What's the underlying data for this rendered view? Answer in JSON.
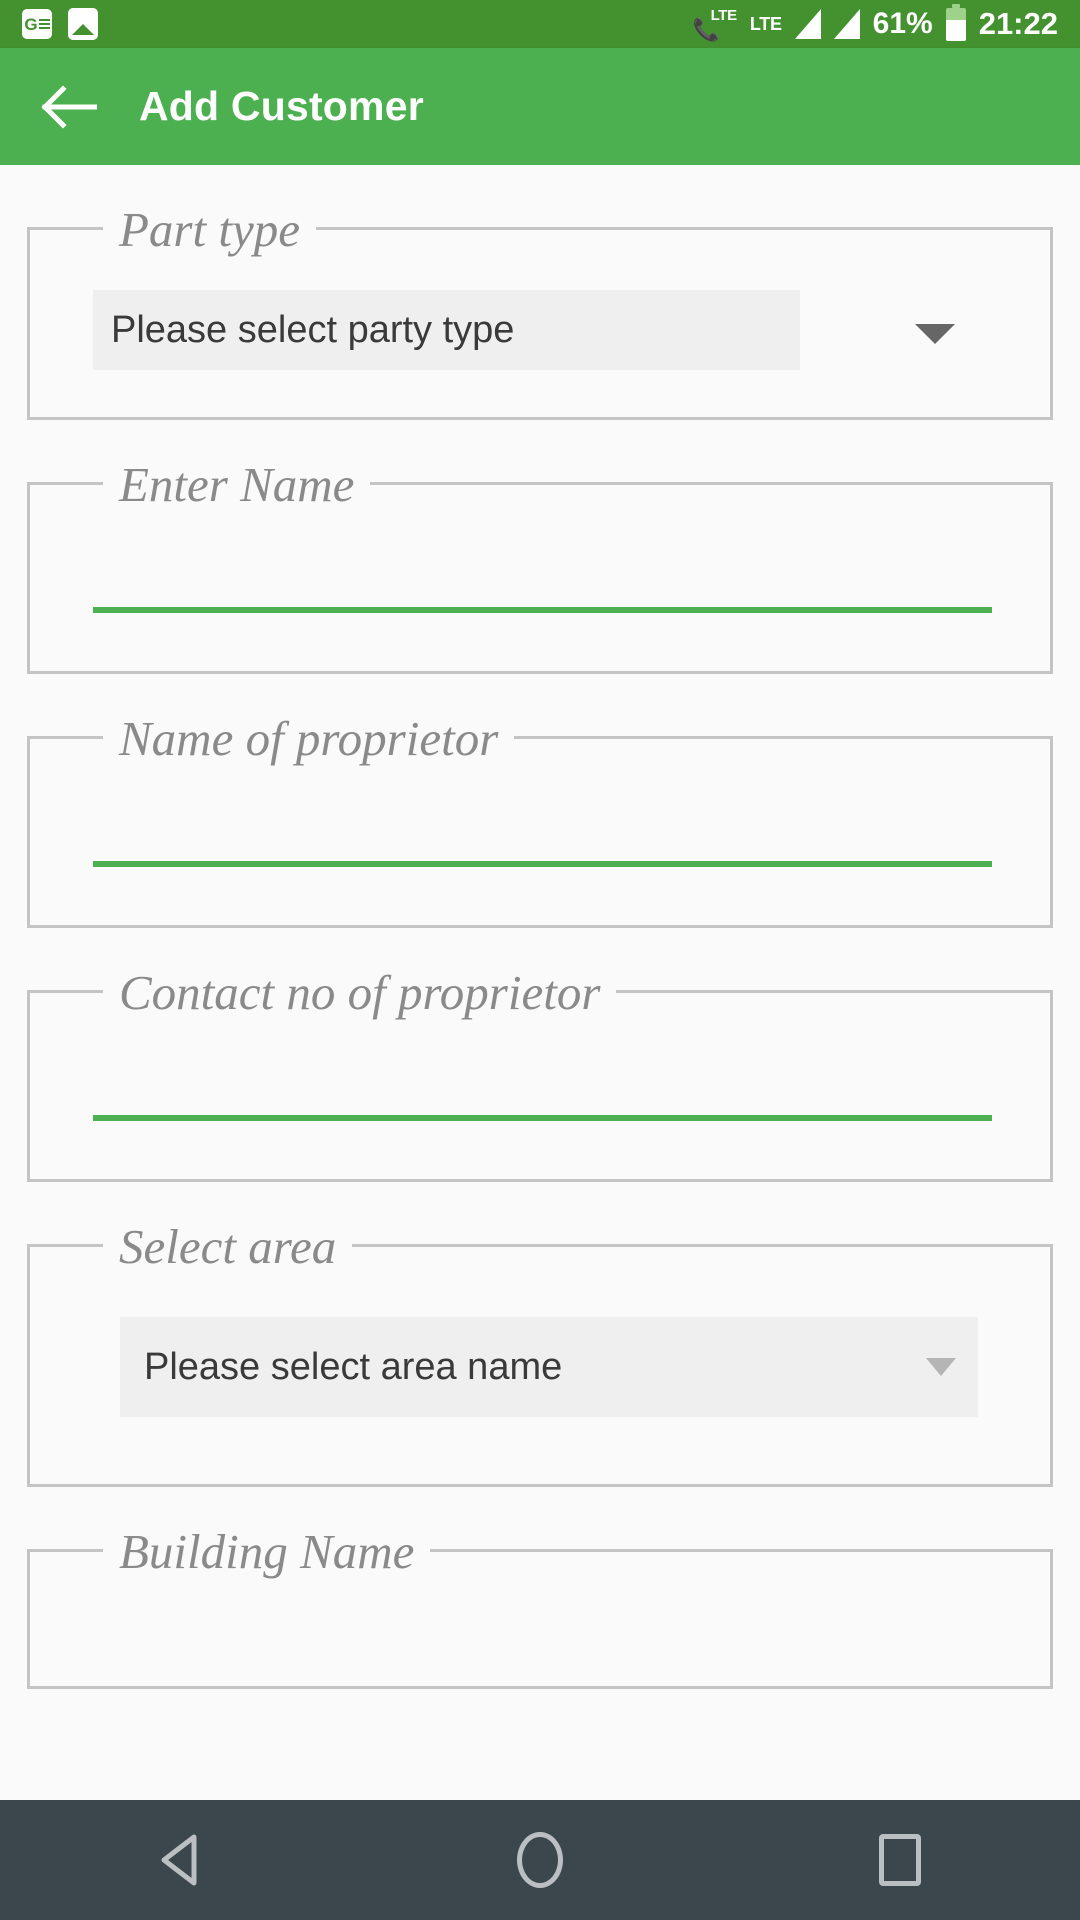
{
  "status_bar": {
    "background": "#43912f",
    "left_icons": [
      {
        "name": "google-news-icon",
        "glyph": "G"
      },
      {
        "name": "photo-icon",
        "glyph": "image"
      }
    ],
    "call_lte_label": "LTE",
    "network_label": "LTE",
    "signal_bars": 2,
    "battery_percent": "61%",
    "clock": "21:22"
  },
  "app_bar": {
    "background": "#4cb050",
    "back_icon": "arrow-left-icon",
    "title": "Add Customer"
  },
  "form": {
    "accent_color": "#4cb050",
    "border_color": "#c4c4c4",
    "fields": [
      {
        "id": "part-type",
        "label": "Part type",
        "type": "dropdown",
        "value": "Please select party type",
        "arrow_icon": "chevron-down-icon"
      },
      {
        "id": "enter-name",
        "label": "Enter Name",
        "type": "text",
        "value": "",
        "placeholder": ""
      },
      {
        "id": "name-of-proprietor",
        "label": "Name of proprietor",
        "type": "text",
        "value": "",
        "placeholder": ""
      },
      {
        "id": "contact-no-of-proprietor",
        "label": "Contact no of proprietor",
        "type": "text",
        "value": "",
        "placeholder": ""
      },
      {
        "id": "select-area",
        "label": "Select area",
        "type": "dropdown",
        "value": "Please select area name",
        "arrow_icon": "chevron-down-icon"
      },
      {
        "id": "building-name",
        "label": "Building Name",
        "type": "text",
        "value": "",
        "placeholder": ""
      }
    ]
  },
  "nav_bar": {
    "background": "#3c464d",
    "buttons": [
      {
        "name": "nav-back-button",
        "icon": "triangle-left-icon"
      },
      {
        "name": "nav-home-button",
        "icon": "circle-icon"
      },
      {
        "name": "nav-recents-button",
        "icon": "square-icon"
      }
    ]
  }
}
